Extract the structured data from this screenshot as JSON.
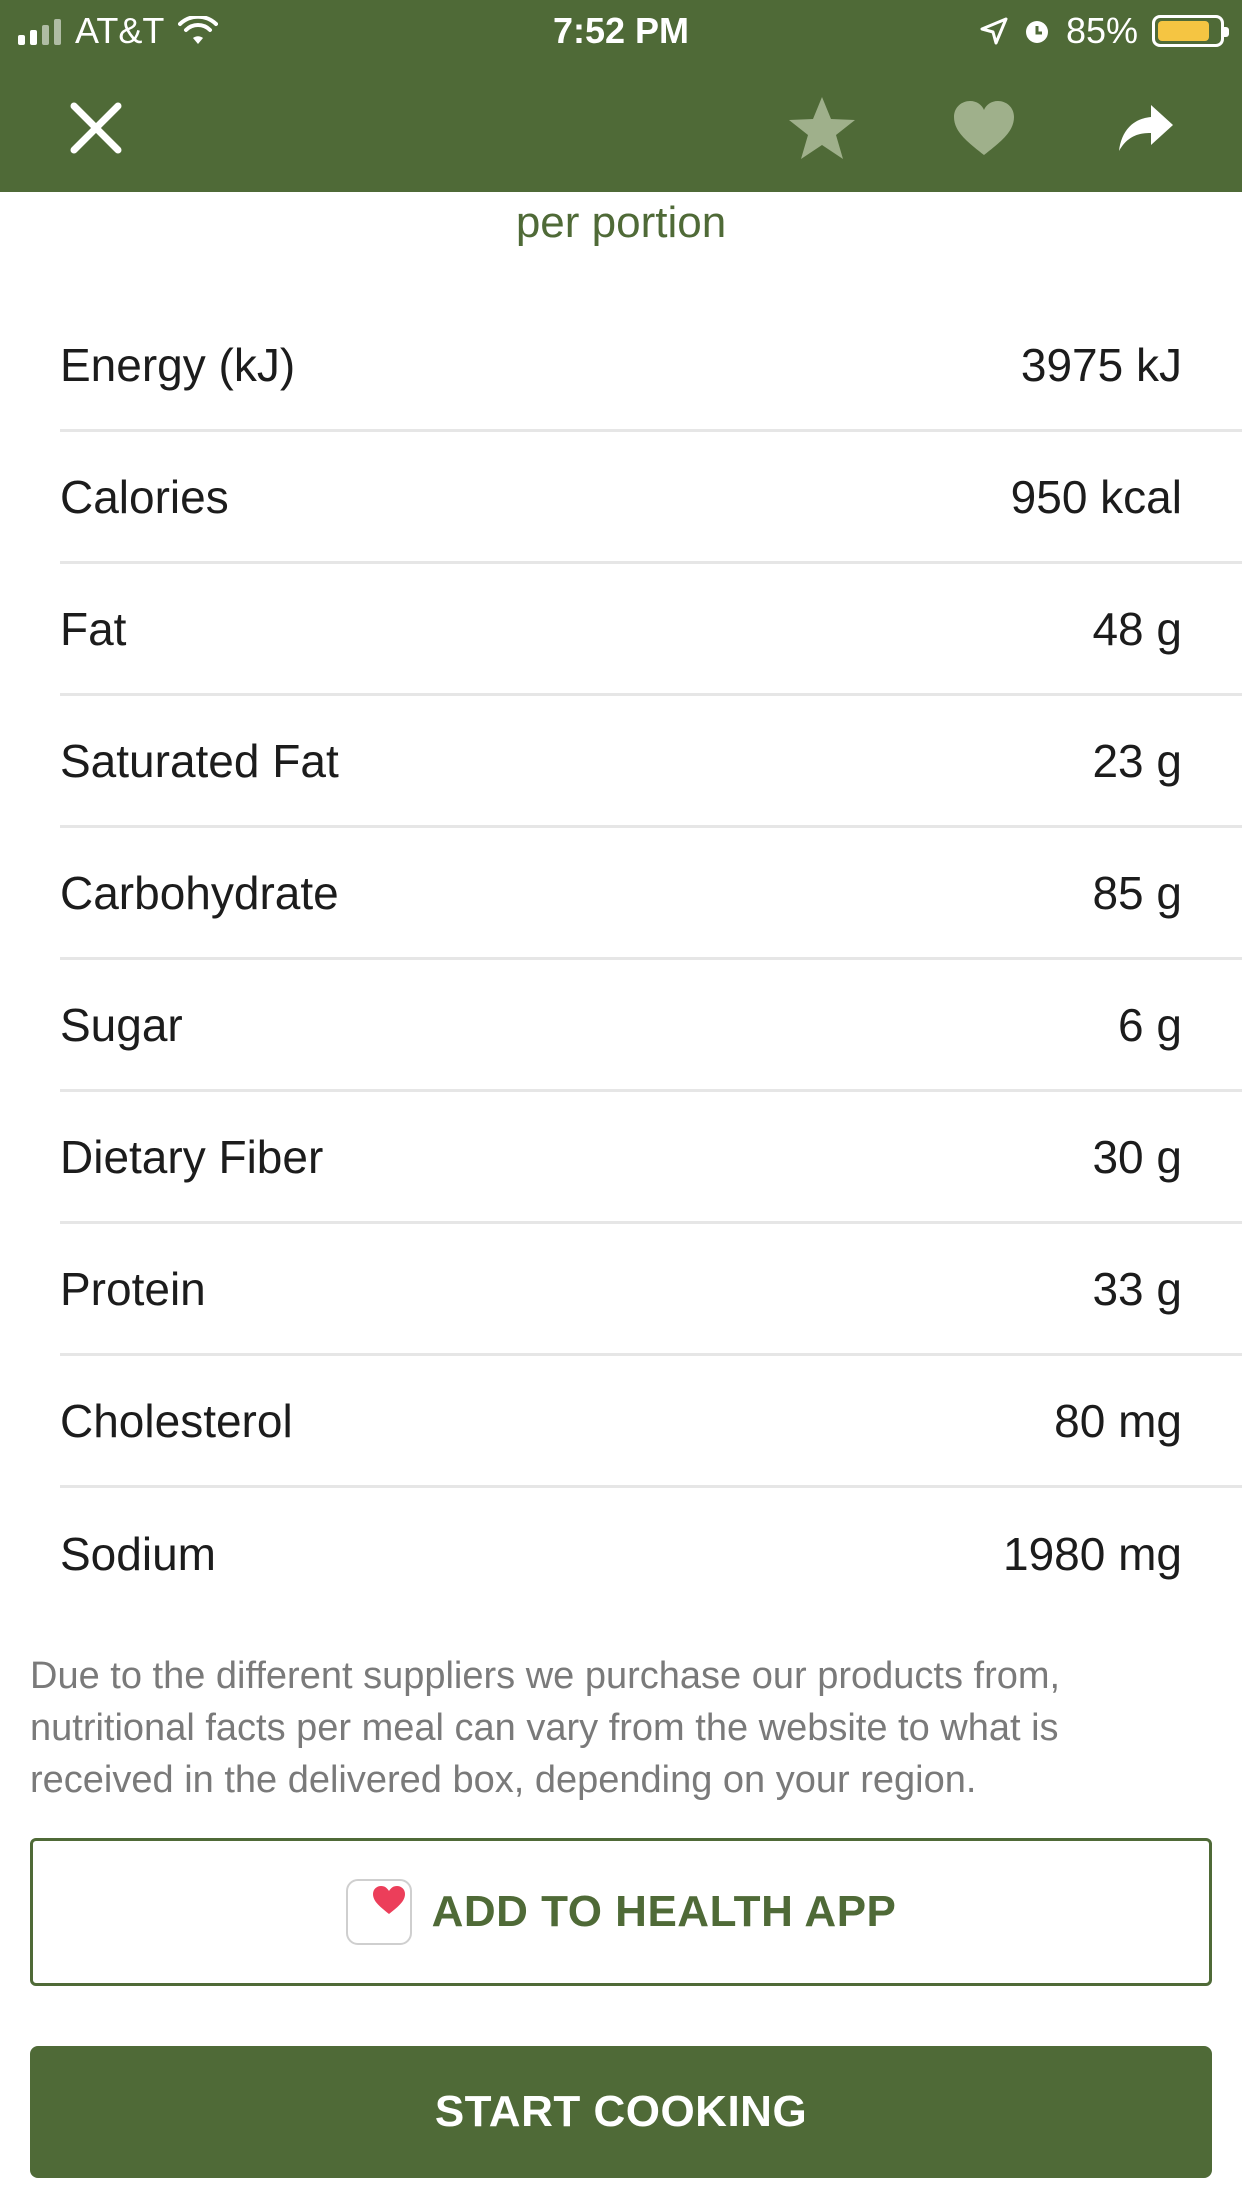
{
  "status_bar": {
    "carrier": "AT&T",
    "time": "7:52 PM",
    "battery_percent": "85%",
    "battery_level": 0.85,
    "battery_color": "#f5c542"
  },
  "nav": {
    "close_icon": "close-icon",
    "favorite_icon": "star-icon",
    "like_icon": "heart-icon",
    "share_icon": "share-icon"
  },
  "nutrition": {
    "heading": "per portion",
    "rows": [
      {
        "label": "Energy (kJ)",
        "value": "3975 kJ"
      },
      {
        "label": "Calories",
        "value": "950 kcal"
      },
      {
        "label": "Fat",
        "value": "48 g"
      },
      {
        "label": "Saturated Fat",
        "value": "23 g"
      },
      {
        "label": "Carbohydrate",
        "value": "85 g"
      },
      {
        "label": "Sugar",
        "value": "6 g"
      },
      {
        "label": "Dietary Fiber",
        "value": "30 g"
      },
      {
        "label": "Protein",
        "value": "33 g"
      },
      {
        "label": "Cholesterol",
        "value": "80 mg"
      },
      {
        "label": "Sodium",
        "value": "1980 mg"
      }
    ]
  },
  "disclaimer": "Due to the different suppliers we purchase our products from, nutritional facts per meal can vary from the website to what is received in the delivered box, depending on your region.",
  "buttons": {
    "health": "ADD TO HEALTH APP",
    "start": "START COOKING"
  },
  "colors": {
    "brand": "#4f6a37",
    "muted_icon": "#9fb08b"
  }
}
